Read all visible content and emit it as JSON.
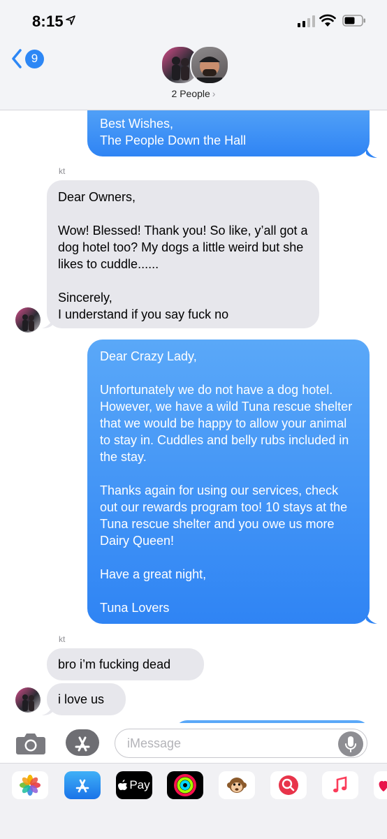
{
  "status_bar": {
    "time": "8:15"
  },
  "header": {
    "back_count": "9",
    "contact_title": "2 People",
    "chevron": "›"
  },
  "messages": {
    "m1": {
      "text": "Best Wishes,\nThe People Down the Hall"
    },
    "m2_sender": "kt",
    "m2": {
      "text": "Dear Owners,\n\nWow! Blessed! Thank you! So like, y’all got a dog hotel too? My dogs a little weird but she likes to cuddle......\n\nSincerely,\nI understand if you say fuck no"
    },
    "m3": {
      "text": "Dear Crazy Lady,\n\nUnfortunately we do not have a dog hotel. However, we have a wild Tuna rescue shelter that we would be happy to allow your animal to stay in. Cuddles and belly rubs included in the stay.\n\nThanks again for using our services, check out our rewards program too! 10 stays at the Tuna rescue shelter and you owe us more Dairy Queen!\n\nHave a great night,\n\nTuna Lovers"
    },
    "m4_sender": "kt",
    "m4": {
      "text": "bro i’m fucking dead"
    },
    "m5": {
      "text": "i love us"
    }
  },
  "input": {
    "placeholder": "iMessage"
  },
  "drawer": {
    "apple_pay_label": "Pay",
    "apps": [
      "photos-icon",
      "app-store-icon",
      "apple-pay-icon",
      "activity-icon",
      "animoji-icon",
      "image-search-icon",
      "music-icon",
      "heart-icon"
    ]
  },
  "colors": {
    "accent_blue": "#2f84f4",
    "incoming_gray": "#e7e7ec",
    "header_bg": "#f3f4f7"
  }
}
